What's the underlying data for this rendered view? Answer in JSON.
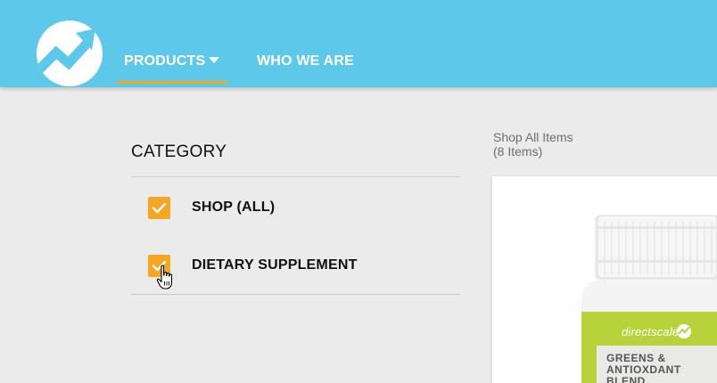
{
  "header": {
    "logo_icon": "trending-up-icon",
    "background_color": "#5ec8ea",
    "accent_color": "#f5a623",
    "tabs": [
      {
        "label": "PRODUCTS",
        "has_dropdown": true,
        "active": true
      },
      {
        "label": "WHO WE ARE",
        "has_dropdown": false,
        "active": false
      }
    ]
  },
  "sidebar": {
    "heading": "CATEGORY",
    "filters": [
      {
        "label": "SHOP (ALL)",
        "checked": true
      },
      {
        "label": "DIETARY SUPPLEMENT",
        "checked": true
      }
    ]
  },
  "main": {
    "title": "Shop All Items",
    "count": "(8 Items)",
    "products": [
      {
        "brand": "directscale",
        "name": "GREENS & ANTIOXDANT BLEND"
      }
    ]
  }
}
